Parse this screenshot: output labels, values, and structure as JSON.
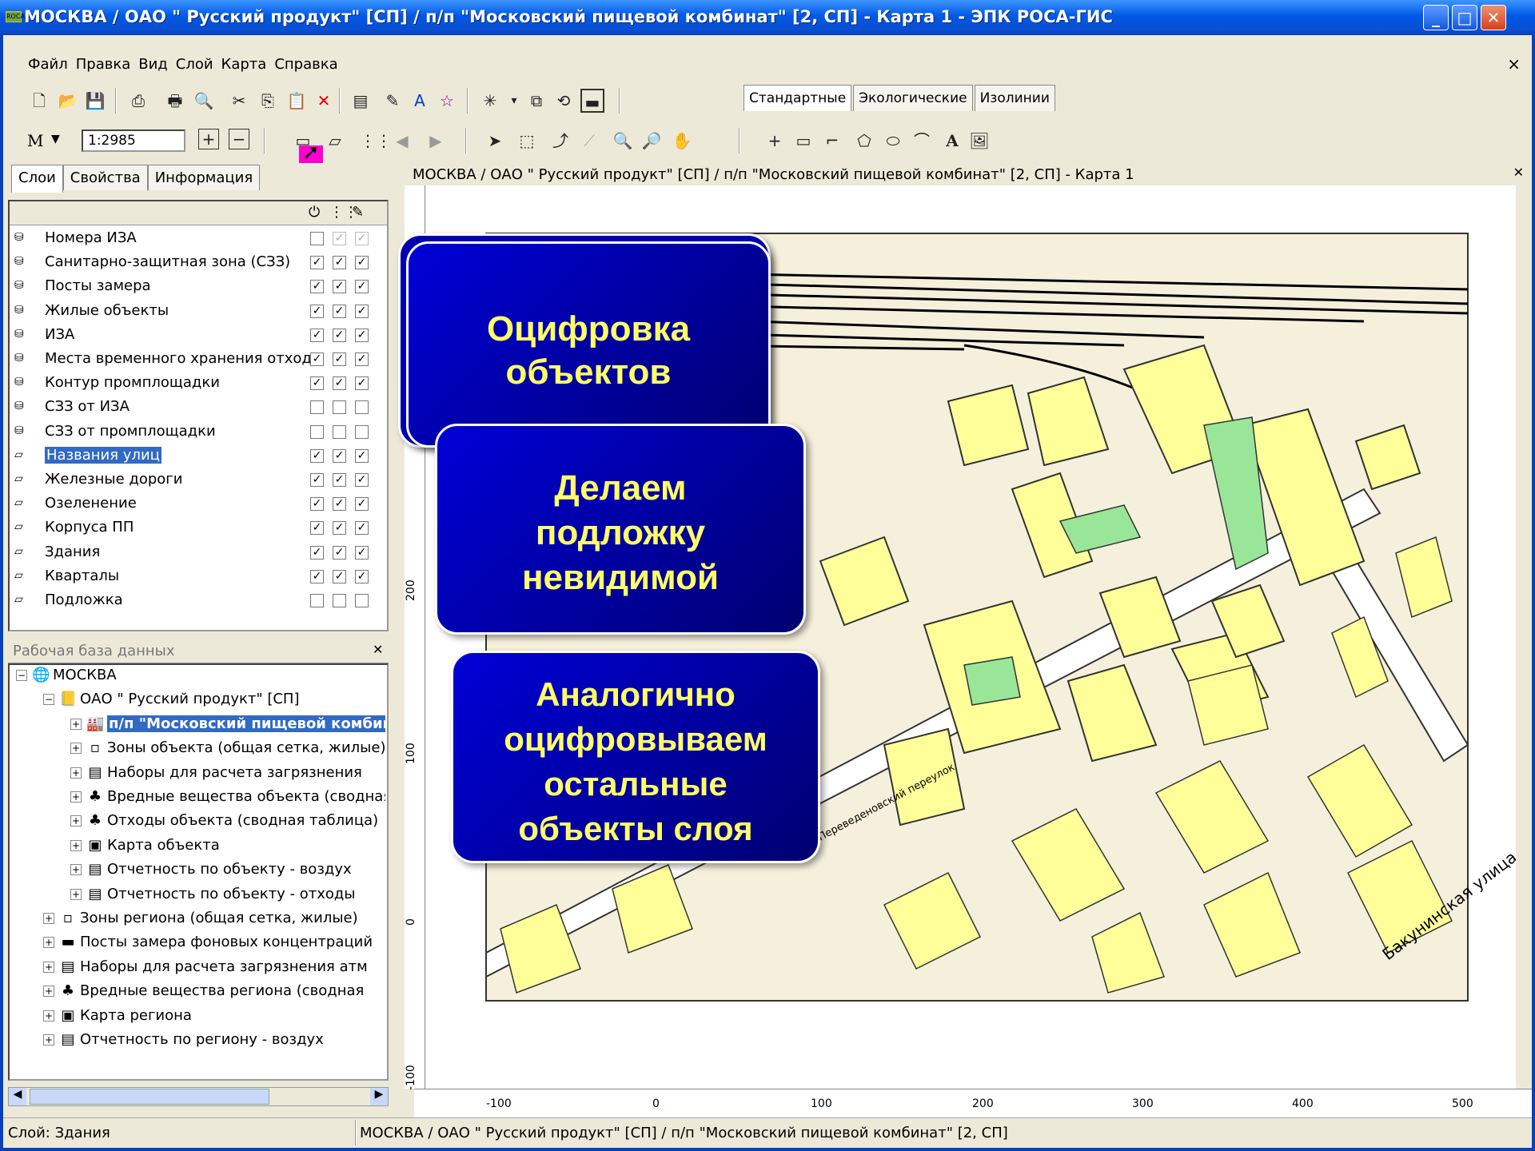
{
  "window": {
    "title": "МОСКВА / ОАО \" Русский продукт\"  [СП] / п/п \"Московский пищевой комбинат\"  [2, СП]  -  Карта 1  -  ЭПК РОСА-ГИС",
    "btn_min": "_",
    "btn_max": "□",
    "btn_close": "✕",
    "icon": "ROCA"
  },
  "menu": [
    "Файл",
    "Правка",
    "Вид",
    "Слой",
    "Карта",
    "Справка"
  ],
  "menu_close": "×",
  "scale": {
    "label": "М",
    "value": "1:2985"
  },
  "std_tabs": [
    "Стандартные",
    "Экологические",
    "Изолинии"
  ],
  "left_tabs": [
    "Слои",
    "Свойства",
    "Информация"
  ],
  "layer_header": [
    "⏻",
    "⋮⋮",
    "✎"
  ],
  "layers": [
    {
      "name": "Номера ИЗА",
      "icon": "db-icon",
      "c": [
        "",
        "✓",
        "✓"
      ],
      "dim": [
        false,
        true,
        true
      ]
    },
    {
      "name": "Санитарно-защитная зона (СЗЗ)",
      "icon": "db-icon",
      "c": [
        "✓",
        "✓",
        "✓"
      ],
      "dim": [
        false,
        false,
        false
      ]
    },
    {
      "name": "Посты замера",
      "icon": "db-icon",
      "c": [
        "✓",
        "✓",
        "✓"
      ],
      "dim": [
        false,
        false,
        false
      ]
    },
    {
      "name": "Жилые объекты",
      "icon": "db-icon",
      "c": [
        "✓",
        "✓",
        "✓"
      ],
      "dim": [
        false,
        false,
        false
      ]
    },
    {
      "name": "ИЗА",
      "icon": "db-icon",
      "c": [
        "✓",
        "✓",
        "✓"
      ],
      "dim": [
        false,
        false,
        false
      ]
    },
    {
      "name": "Места временного хранения отходов",
      "icon": "db-icon",
      "c": [
        "✓",
        "✓",
        "✓"
      ],
      "dim": [
        false,
        false,
        false
      ]
    },
    {
      "name": "Контур промплощадки",
      "icon": "db-icon",
      "c": [
        "✓",
        "✓",
        "✓"
      ],
      "dim": [
        false,
        false,
        false
      ]
    },
    {
      "name": "СЗЗ от ИЗА",
      "icon": "db-icon",
      "c": [
        "",
        "",
        ""
      ],
      "dim": [
        false,
        false,
        false
      ]
    },
    {
      "name": "СЗЗ от промплощадки",
      "icon": "db-icon",
      "c": [
        "",
        "",
        ""
      ],
      "dim": [
        false,
        false,
        false
      ]
    },
    {
      "name": "Названия улиц",
      "icon": "layer-icon",
      "c": [
        "✓",
        "✓",
        "✓"
      ],
      "dim": [
        false,
        false,
        false
      ],
      "selected": true
    },
    {
      "name": "Железные дороги",
      "icon": "layer-icon",
      "c": [
        "✓",
        "✓",
        "✓"
      ],
      "dim": [
        false,
        false,
        false
      ]
    },
    {
      "name": "Озеленение",
      "icon": "layer-icon",
      "c": [
        "✓",
        "✓",
        "✓"
      ],
      "dim": [
        false,
        false,
        false
      ]
    },
    {
      "name": "Корпуса ПП",
      "icon": "layer-icon",
      "c": [
        "✓",
        "✓",
        "✓"
      ],
      "dim": [
        false,
        false,
        false
      ]
    },
    {
      "name": "Здания",
      "icon": "layer-icon",
      "c": [
        "✓",
        "✓",
        "✓"
      ],
      "dim": [
        false,
        false,
        false
      ]
    },
    {
      "name": "Кварталы",
      "icon": "layer-icon",
      "c": [
        "✓",
        "✓",
        "✓"
      ],
      "dim": [
        false,
        false,
        false
      ]
    },
    {
      "name": "Подложка",
      "icon": "layer-icon",
      "c": [
        "",
        "",
        ""
      ],
      "dim": [
        false,
        false,
        false
      ]
    }
  ],
  "db_title": "Рабочая база данных",
  "db_close": "✕",
  "tree": [
    {
      "text": "МОСКВА",
      "level": 0,
      "sign": "−",
      "icon": "🌐"
    },
    {
      "text": "ОАО \" Русский продукт\"  [СП]",
      "level": 1,
      "sign": "−",
      "icon": "📒"
    },
    {
      "text": "п/п \"Московский пищевой комбинат\"",
      "level": 2,
      "sign": "+",
      "icon": "🏭",
      "bold": true
    },
    {
      "text": "Зоны объекта (общая сетка, жилые)",
      "level": 2,
      "sign": "+",
      "icon": "▫"
    },
    {
      "text": "Наборы для расчета загрязнения",
      "level": 2,
      "sign": "+",
      "icon": "▤"
    },
    {
      "text": "Вредные вещества объекта (сводная)",
      "level": 2,
      "sign": "+",
      "icon": "♣"
    },
    {
      "text": "Отходы объекта (сводная таблица)",
      "level": 2,
      "sign": "+",
      "icon": "♣"
    },
    {
      "text": "Карта объекта",
      "level": 2,
      "sign": "+",
      "icon": "▣"
    },
    {
      "text": "Отчетность по объекту - воздух",
      "level": 2,
      "sign": "+",
      "icon": "▤"
    },
    {
      "text": "Отчетность по объекту - отходы",
      "level": 2,
      "sign": "+",
      "icon": "▤"
    },
    {
      "text": "Зоны региона (общая сетка, жилые)",
      "level": 1,
      "sign": "+",
      "icon": "▫"
    },
    {
      "text": "Посты замера фоновых концентраций",
      "level": 1,
      "sign": "+",
      "icon": "▬"
    },
    {
      "text": "Наборы для расчета загрязнения атм",
      "level": 1,
      "sign": "+",
      "icon": "▤"
    },
    {
      "text": "Вредные вещества региона (сводная",
      "level": 1,
      "sign": "+",
      "icon": "♣"
    },
    {
      "text": "Карта региона",
      "level": 1,
      "sign": "+",
      "icon": "▣"
    },
    {
      "text": "Отчетность по региону - воздух",
      "level": 1,
      "sign": "+",
      "icon": "▤"
    }
  ],
  "map": {
    "title": "МОСКВА / ОАО \" Русский продукт\"  [СП] / п/п \"Московский пищевой комбинат\"  [2, СП]  -  Карта 1",
    "close": "✕",
    "streets": [
      "Переведеновский переулок",
      "Бакунинская улица"
    ],
    "hticks": [
      "-100",
      "0",
      "100",
      "200",
      "300",
      "400",
      "500"
    ],
    "vticks": [
      "200",
      "100",
      "0",
      "-100"
    ]
  },
  "callouts": [
    {
      "lines": [
        "Оцифровка",
        "объектов"
      ]
    },
    {
      "lines": [
        "Делаем",
        "подложку",
        "невидимой"
      ]
    },
    {
      "lines": [
        "Аналогично",
        "оцифровываем",
        "остальные",
        "объекты слоя"
      ]
    }
  ],
  "status": {
    "layer": "Слой: Здания",
    "path": "МОСКВА / ОАО \" Русский продукт\"  [СП] / п/п \"Московский пищевой комбинат\"  [2, СП]"
  },
  "colors": {
    "building": "#ffff99",
    "green": "#99e699",
    "quarter": "#f5f0dc",
    "callout_text": "#ffff66",
    "callout_bg": "#0000c8"
  }
}
